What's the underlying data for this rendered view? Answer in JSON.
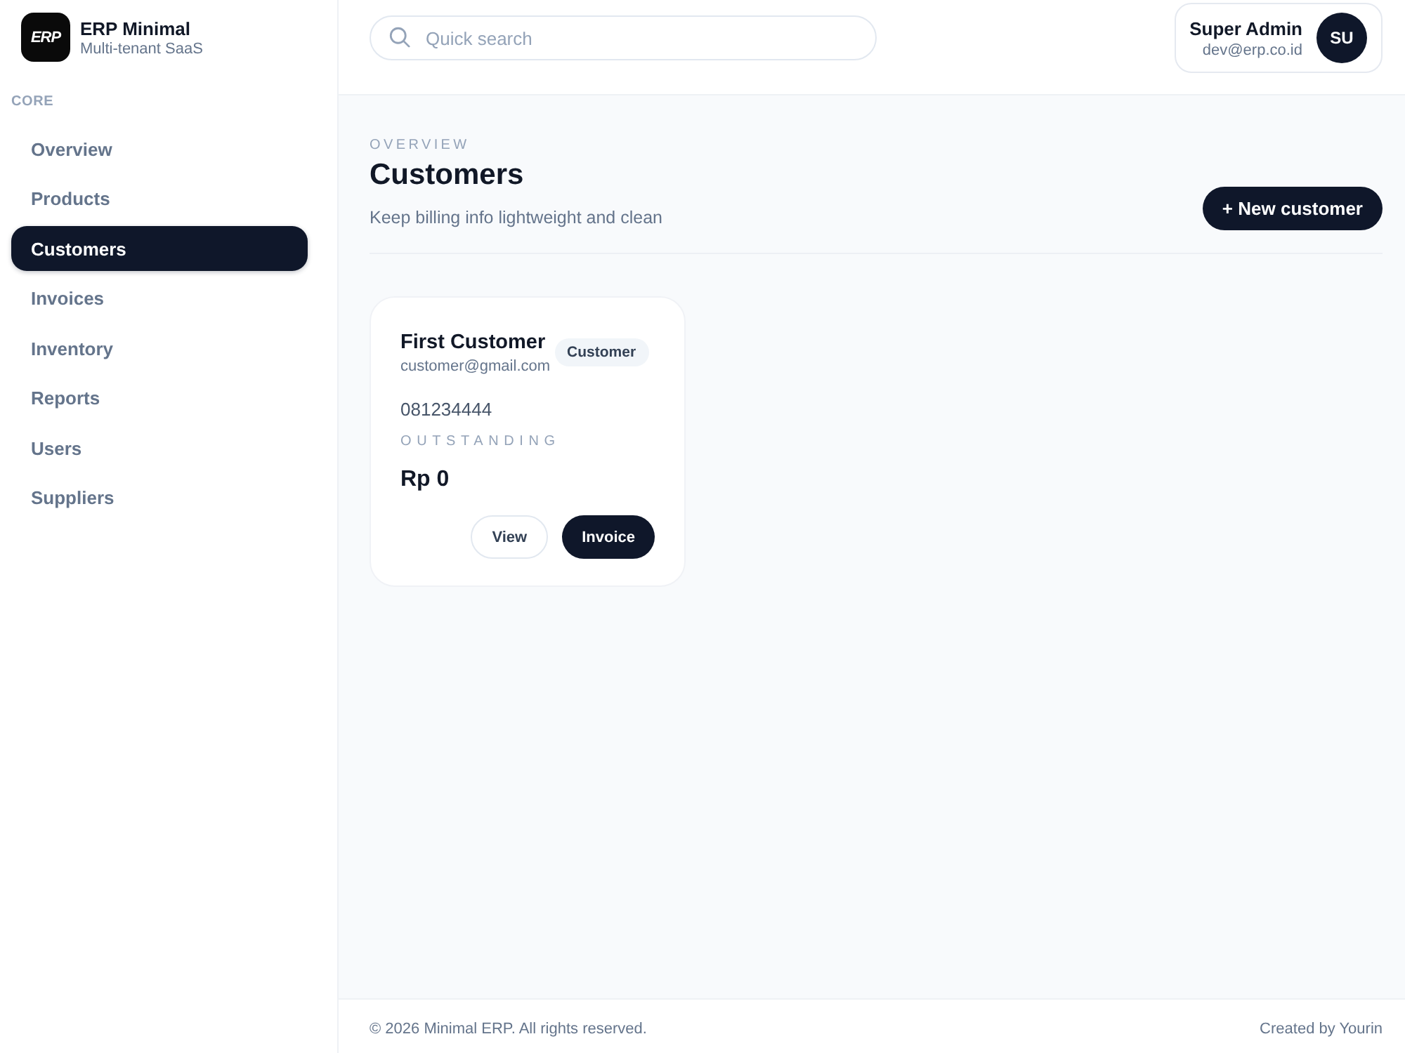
{
  "sidebar": {
    "brand": {
      "logo_text": "ERP",
      "title": "ERP Minimal",
      "subtitle": "Multi-tenant SaaS"
    },
    "section_label": "CORE",
    "items": [
      {
        "label": "Overview",
        "selected": false
      },
      {
        "label": "Products",
        "selected": false
      },
      {
        "label": "Customers",
        "selected": true
      },
      {
        "label": "Invoices",
        "selected": false
      },
      {
        "label": "Inventory",
        "selected": false
      },
      {
        "label": "Reports",
        "selected": false
      },
      {
        "label": "Users",
        "selected": false
      },
      {
        "label": "Suppliers",
        "selected": false
      }
    ]
  },
  "topbar": {
    "search": {
      "placeholder": "Quick search"
    },
    "user": {
      "name": "Super Admin",
      "email": "dev@erp.co.id",
      "initials": "SU"
    }
  },
  "page": {
    "eyebrow": "OVERVIEW",
    "title": "Customers",
    "subtitle": "Keep billing info lightweight and clean",
    "primary_action": "+ New customer"
  },
  "customers": [
    {
      "name": "First Customer",
      "email": "customer@gmail.com",
      "badge": "Customer",
      "phone": "081234444",
      "outstanding_label": "OUTSTANDING",
      "outstanding": "Rp 0",
      "actions": [
        {
          "label": "View",
          "kind": "secondary"
        },
        {
          "label": "Invoice",
          "kind": "primary"
        }
      ]
    }
  ],
  "footer": {
    "copyright": "© 2026 Minimal ERP. All rights reserved.",
    "credit": "Created by Yourin"
  }
}
